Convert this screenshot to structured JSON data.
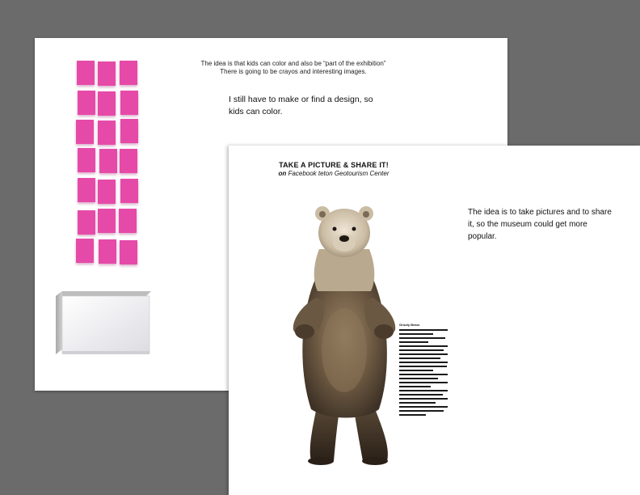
{
  "page1": {
    "line1": "The idea is that kids can color and also be “part of the exhibition”",
    "line2": "There is going to be crayos and interesting images.",
    "design_note": "I still have to make or find a design, so kids can color.",
    "sticky_note_color": "#e64aa8"
  },
  "page2": {
    "title": "TAKE A PICTURE & SHARE IT!",
    "subtitle_prefix": "on",
    "subtitle_rest": "Facebook teton Geotourism Center",
    "share_note": "The idea is to take pictures and to share it, so the museum could get more popular.",
    "info_title": "Grizzly Bears"
  }
}
